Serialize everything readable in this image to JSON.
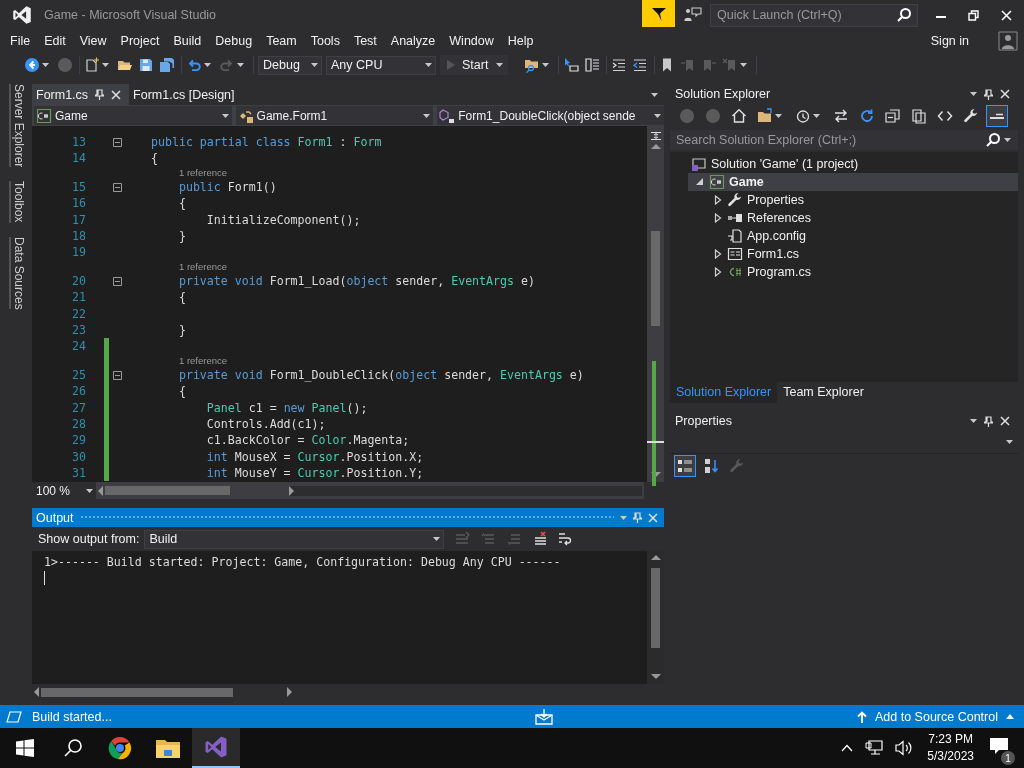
{
  "window": {
    "title": "Game - Microsoft Visual Studio",
    "quick_launch": {
      "placeholder": "Quick Launch (Ctrl+Q)"
    }
  },
  "menu": [
    "File",
    "Edit",
    "View",
    "Project",
    "Build",
    "Debug",
    "Team",
    "Tools",
    "Test",
    "Analyze",
    "Window",
    "Help"
  ],
  "account": {
    "label": "Sign in"
  },
  "toolbar": {
    "left": [
      [
        {
          "kind": "back",
          "disabled": false,
          "menu": true
        },
        {
          "kind": "forward",
          "disabled": true,
          "menu": false
        }
      ],
      [
        {
          "kind": "new_project",
          "disabled": false,
          "menu": true
        },
        {
          "kind": "open",
          "disabled": false,
          "menu": false
        },
        {
          "kind": "save",
          "disabled": false,
          "menu": false
        },
        {
          "kind": "save_all",
          "disabled": false,
          "menu": false
        }
      ],
      [
        {
          "kind": "undo",
          "disabled": false,
          "menu": true
        },
        {
          "kind": "redo",
          "disabled": true,
          "menu": true
        }
      ]
    ],
    "configuration": "Debug",
    "platform": "Any CPU",
    "start": "Start",
    "right": [
      [
        {
          "kind": "find_files",
          "disabled": false,
          "menu": true
        }
      ],
      [
        {
          "kind": "select_element",
          "disabled": false,
          "menu": false
        },
        {
          "kind": "properties_window",
          "disabled": false,
          "menu": false
        }
      ],
      [
        {
          "kind": "indent",
          "disabled": false,
          "menu": false
        },
        {
          "kind": "outdent",
          "disabled": false,
          "menu": false
        }
      ],
      [
        {
          "kind": "bookmark",
          "disabled": false,
          "menu": false
        },
        {
          "kind": "bookmark_prev",
          "disabled": true,
          "menu": false
        },
        {
          "kind": "bookmark_next",
          "disabled": true,
          "menu": false
        },
        {
          "kind": "bookmark_clear",
          "disabled": true,
          "menu": true
        }
      ]
    ]
  },
  "side_tabs": [
    "Server Explorer",
    "Toolbox",
    "Data Sources"
  ],
  "editor": {
    "tabs": [
      {
        "label": "Form1.cs",
        "selected": true
      },
      {
        "label": "Form1.cs [Design]",
        "selected": false
      }
    ],
    "nav": [
      {
        "kind": "project",
        "label": "Game"
      },
      {
        "kind": "class",
        "label": "Game.Form1"
      },
      {
        "kind": "method",
        "label": "Form1_DoubleClick(object sende"
      }
    ],
    "lines": [
      {
        "kind": "code",
        "number": "13",
        "fold": true,
        "changed": false,
        "tokens": [
          {
            "kind": "keyword",
            "s": "public partial class "
          },
          {
            "kind": "type",
            "s": "Form1"
          },
          {
            "kind": "plain",
            "s": " : "
          },
          {
            "kind": "type",
            "s": "Form"
          }
        ]
      },
      {
        "kind": "code",
        "number": "14",
        "fold": false,
        "changed": false,
        "tokens": [
          {
            "kind": "plain",
            "s": "{"
          }
        ]
      },
      {
        "kind": "lens",
        "text": "1 reference",
        "changed": false
      },
      {
        "kind": "code",
        "number": "15",
        "fold": true,
        "changed": false,
        "tokens": [
          {
            "kind": "keyword",
            "s": "    public"
          },
          {
            "kind": "plain",
            "s": " Form1()"
          }
        ]
      },
      {
        "kind": "code",
        "number": "16",
        "fold": false,
        "changed": false,
        "tokens": [
          {
            "kind": "plain",
            "s": "    {"
          }
        ]
      },
      {
        "kind": "code",
        "number": "17",
        "fold": false,
        "changed": false,
        "tokens": [
          {
            "kind": "plain",
            "s": "        InitializeComponent();"
          }
        ]
      },
      {
        "kind": "code",
        "number": "18",
        "fold": false,
        "changed": false,
        "tokens": [
          {
            "kind": "plain",
            "s": "    }"
          }
        ]
      },
      {
        "kind": "code",
        "number": "19",
        "fold": false,
        "changed": false
      },
      {
        "kind": "lens",
        "text": "1 reference",
        "changed": false
      },
      {
        "kind": "code",
        "number": "20",
        "fold": true,
        "changed": false,
        "tokens": [
          {
            "kind": "keyword",
            "s": "    private void"
          },
          {
            "kind": "plain",
            "s": " Form1_Load("
          },
          {
            "kind": "keyword",
            "s": "object"
          },
          {
            "kind": "plain",
            "s": " sender, "
          },
          {
            "kind": "type",
            "s": "EventArgs"
          },
          {
            "kind": "plain",
            "s": " e)"
          }
        ]
      },
      {
        "kind": "code",
        "number": "21",
        "fold": false,
        "changed": false,
        "tokens": [
          {
            "kind": "plain",
            "s": "    {"
          }
        ]
      },
      {
        "kind": "code",
        "number": "22",
        "fold": false,
        "changed": false
      },
      {
        "kind": "code",
        "number": "23",
        "fold": false,
        "changed": false,
        "tokens": [
          {
            "kind": "plain",
            "s": "    }"
          }
        ]
      },
      {
        "kind": "code",
        "number": "24",
        "fold": false,
        "changed": true
      },
      {
        "kind": "lens",
        "text": "1 reference",
        "changed": true
      },
      {
        "kind": "code",
        "number": "25",
        "fold": true,
        "changed": true,
        "tokens": [
          {
            "kind": "keyword",
            "s": "    private void"
          },
          {
            "kind": "plain",
            "s": " Form1_DoubleClick("
          },
          {
            "kind": "keyword",
            "s": "object"
          },
          {
            "kind": "plain",
            "s": " sender, "
          },
          {
            "kind": "type",
            "s": "EventArgs"
          },
          {
            "kind": "plain",
            "s": " e)"
          }
        ]
      },
      {
        "kind": "code",
        "number": "26",
        "fold": false,
        "changed": true,
        "tokens": [
          {
            "kind": "plain",
            "s": "    {"
          }
        ]
      },
      {
        "kind": "code",
        "number": "27",
        "fold": false,
        "changed": true,
        "tokens": [
          {
            "kind": "type",
            "s": "        Panel"
          },
          {
            "kind": "plain",
            "s": " c1 = "
          },
          {
            "kind": "keyword",
            "s": "new "
          },
          {
            "kind": "type",
            "s": "Panel"
          },
          {
            "kind": "plain",
            "s": "();"
          }
        ]
      },
      {
        "kind": "code",
        "number": "28",
        "fold": false,
        "changed": true,
        "tokens": [
          {
            "kind": "plain",
            "s": "        Controls.Add(c1);"
          }
        ]
      },
      {
        "kind": "code",
        "number": "29",
        "fold": false,
        "changed": true,
        "tokens": [
          {
            "kind": "plain",
            "s": "        c1.BackColor = "
          },
          {
            "kind": "type",
            "s": "Color"
          },
          {
            "kind": "plain",
            "s": ".Magenta;"
          }
        ]
      },
      {
        "kind": "code",
        "number": "30",
        "fold": false,
        "changed": true,
        "tokens": [
          {
            "kind": "keyword",
            "s": "        int"
          },
          {
            "kind": "plain",
            "s": " MouseX = "
          },
          {
            "kind": "type",
            "s": "Cursor"
          },
          {
            "kind": "plain",
            "s": ".Position.X;"
          }
        ]
      },
      {
        "kind": "code",
        "number": "31",
        "fold": false,
        "changed": true,
        "tokens": [
          {
            "kind": "keyword",
            "s": "        int"
          },
          {
            "kind": "plain",
            "s": " MouseY = "
          },
          {
            "kind": "type",
            "s": "Cursor"
          },
          {
            "kind": "plain",
            "s": ".Position.Y;"
          }
        ]
      }
    ],
    "zoom": "100 %"
  },
  "output": {
    "title": "Output",
    "source_label": "Show output from:",
    "source": "Build",
    "tools": [
      {
        "kind": "goto_source",
        "disabled": true
      },
      {
        "kind": "prev_message",
        "disabled": true
      },
      {
        "kind": "next_message",
        "disabled": true
      },
      {
        "kind": "clear_all",
        "disabled": false
      },
      {
        "kind": "word_wrap",
        "disabled": false
      }
    ],
    "lines": [
      "1>------ Build started: Project: Game, Configuration: Debug Any CPU ------"
    ]
  },
  "solution_explorer": {
    "title": "Solution Explorer",
    "tools": [
      {
        "kind": "back",
        "disabled": true,
        "menu": false,
        "on": false
      },
      {
        "kind": "forward",
        "disabled": true,
        "menu": false,
        "on": false
      },
      {
        "kind": "home",
        "disabled": false,
        "menu": false,
        "on": false
      },
      {
        "kind": "sync_folder",
        "disabled": false,
        "menu": true,
        "on": false
      },
      {
        "kind": "history",
        "disabled": false,
        "menu": true,
        "on": false
      },
      {
        "kind": "switch_views",
        "disabled": false,
        "menu": false,
        "on": false
      },
      {
        "kind": "refresh",
        "disabled": false,
        "menu": false,
        "on": false
      },
      {
        "kind": "collapse_all",
        "disabled": false,
        "menu": false,
        "on": false
      },
      {
        "kind": "show_all",
        "disabled": false,
        "menu": false,
        "on": false
      },
      {
        "kind": "view_code",
        "disabled": false,
        "menu": false,
        "on": false
      },
      {
        "kind": "wrench",
        "disabled": false,
        "menu": false,
        "on": false
      },
      {
        "kind": "preview",
        "disabled": false,
        "menu": false,
        "on": true
      }
    ],
    "search": {
      "placeholder": "Search Solution Explorer (Ctrl+;)"
    },
    "tree": [
      {
        "kind": "solution",
        "label": "Solution 'Game' (1 project)",
        "selected": false,
        "children": [
          {
            "kind": "project",
            "label": "Game",
            "selected": true,
            "expanded": true,
            "children": [
              {
                "kind": "properties",
                "label": "Properties",
                "selected": false,
                "expanded": false
              },
              {
                "kind": "references",
                "label": "References",
                "selected": false,
                "expanded": false
              },
              {
                "kind": "config",
                "label": "App.config",
                "selected": false
              },
              {
                "kind": "form",
                "label": "Form1.cs",
                "selected": false,
                "expanded": false
              },
              {
                "kind": "csharp",
                "label": "Program.cs",
                "selected": false,
                "expanded": false
              }
            ]
          }
        ]
      }
    ],
    "tabs": [
      {
        "label": "Solution Explorer",
        "selected": true
      },
      {
        "label": "Team Explorer",
        "selected": false
      }
    ]
  },
  "properties": {
    "title": "Properties",
    "tools": [
      {
        "kind": "categorized",
        "on": true,
        "disabled": false
      },
      {
        "kind": "alphabetical",
        "on": false,
        "disabled": false
      },
      {
        "kind": "property_pages",
        "on": false,
        "disabled": true
      }
    ]
  },
  "status_bar": {
    "message": "Build started...",
    "source_control": "Add to Source Control"
  },
  "taskbar": {
    "pinned": [
      {
        "kind": "browser",
        "selected": false
      },
      {
        "kind": "folder",
        "selected": false
      },
      {
        "kind": "visual_studio",
        "selected": true
      }
    ],
    "time": "7:23 PM",
    "date": "5/3/2023",
    "notifications": "1"
  }
}
